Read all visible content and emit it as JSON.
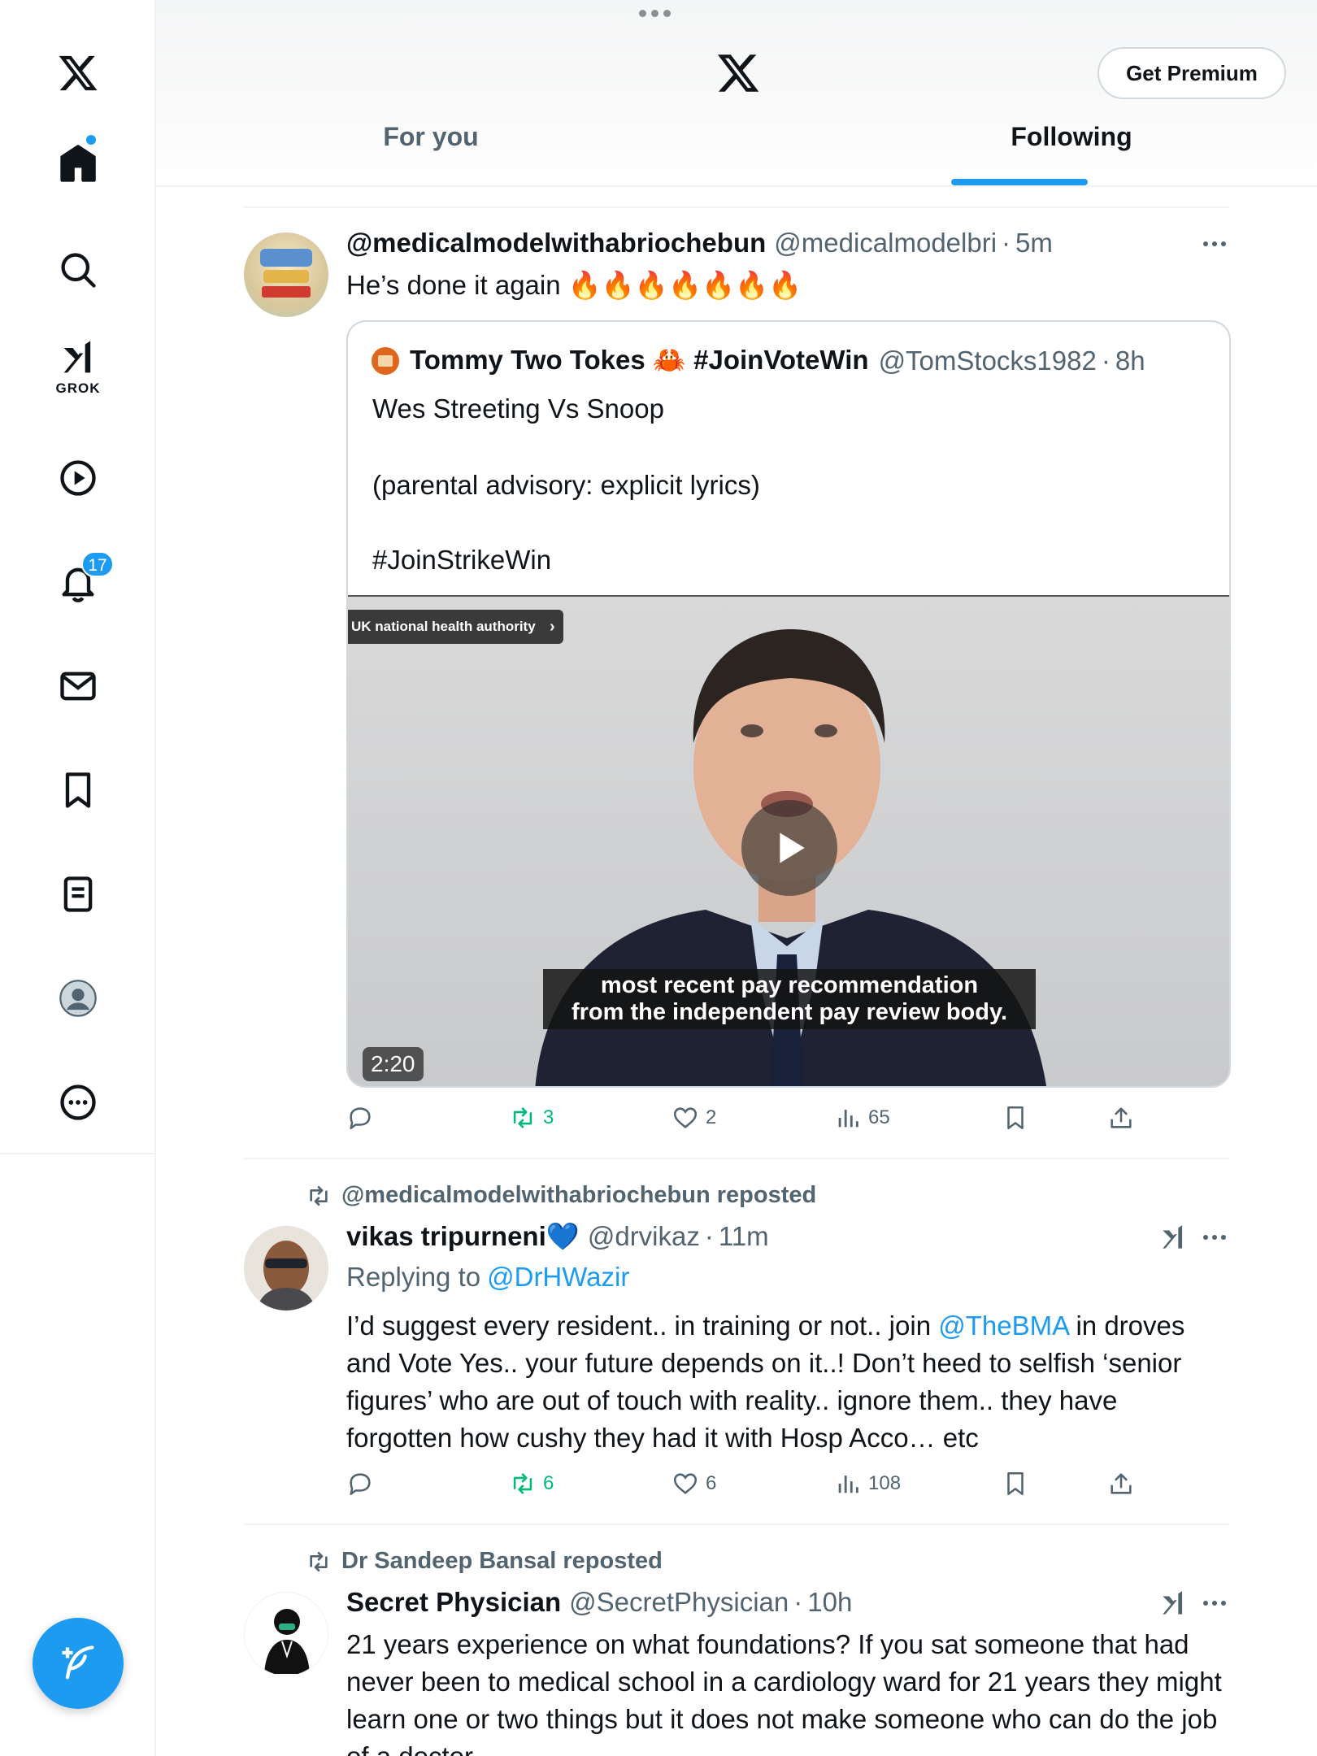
{
  "sidebar": {
    "grok_label": "GROK",
    "notifications_count": "17"
  },
  "header": {
    "premium_label": "Get Premium",
    "tabs": [
      {
        "label": "For you",
        "selected": false
      },
      {
        "label": "Following",
        "selected": true
      }
    ]
  },
  "posts": [
    {
      "name": "@medicalmodelwithabriochebun",
      "handle": "@medicalmodelbri",
      "time": "5m",
      "text": "He’s done it again 🔥🔥🔥🔥🔥🔥🔥",
      "quote": {
        "name": "Tommy Two Tokes 🦀 #JoinVoteWin",
        "handle": "@TomStocks1982",
        "time": "8h",
        "line1": "Wes Streeting Vs Snoop",
        "line2": "(parental advisory: explicit lyrics)",
        "line3": "#JoinStrikeWin",
        "video": {
          "chip": "UK national health authority",
          "caption_line1": "most recent pay recommendation",
          "caption_line2": "from the independent pay review body.",
          "duration": "2:20"
        }
      },
      "stats": {
        "replies": "",
        "reposts": "3",
        "likes": "2",
        "views": "65"
      }
    },
    {
      "reposted_by": "@medicalmodelwithabriochebun reposted",
      "name": "vikas tripurneni💙",
      "handle": "@drvikaz",
      "time": "11m",
      "replying_prefix": "Replying to ",
      "replying_to": "@DrHWazir",
      "text_a": "I’d suggest every resident.. in training or not.. join ",
      "text_mention": "@TheBMA",
      "text_b": " in droves and Vote Yes.. your future depends on it..! Don’t heed to selfish ‘senior figures’ who are out of touch with reality.. ignore them.. they have forgotten how cushy they had it with Hosp Acco… etc",
      "stats": {
        "replies": "",
        "reposts": "6",
        "likes": "6",
        "views": "108"
      }
    },
    {
      "reposted_by": "Dr Sandeep Bansal reposted",
      "name": "Secret Physician",
      "handle": "@SecretPhysician",
      "time": "10h",
      "text": "21 years experience on what foundations? If you sat someone that had never been to medical school in a cardiology ward for 21 years they might learn one or two things but it does not make someone who can do the job of a doctor."
    }
  ],
  "colors": {
    "accent": "#1d9bf0",
    "repost_green": "#00ba7c",
    "muted": "#536471"
  }
}
